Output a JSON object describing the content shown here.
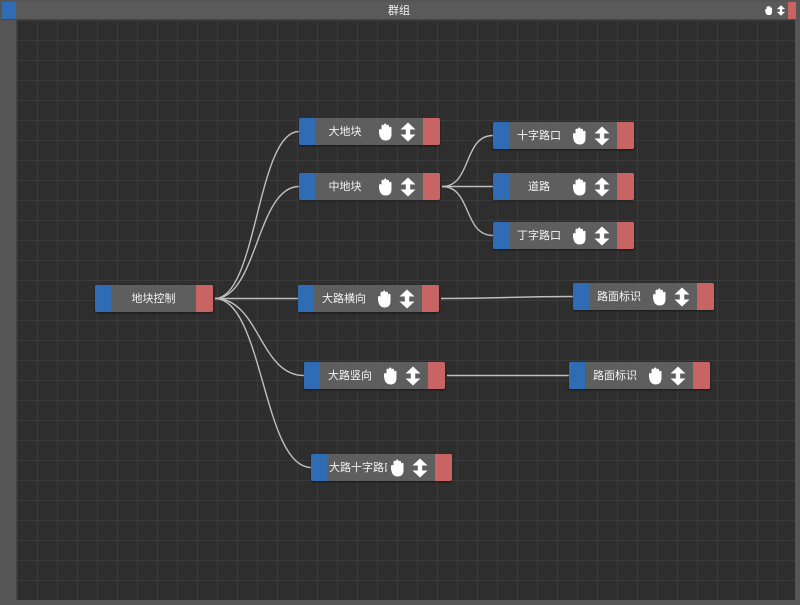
{
  "window": {
    "title": "群组"
  },
  "icons": {
    "grab": "hand-icon",
    "move": "vertical-move-icon"
  },
  "colors": {
    "input_port": "#2f6cb3",
    "output_port": "#c96464",
    "node_body": "#5e5e5e",
    "canvas": "#2e2e2e",
    "edge": "#bfbfbf"
  },
  "nodes": [
    {
      "id": "root",
      "label": "地块控制",
      "has_icons": false
    },
    {
      "id": "big",
      "label": "大地块",
      "has_icons": true
    },
    {
      "id": "mid",
      "label": "中地块",
      "has_icons": true
    },
    {
      "id": "cross",
      "label": "十字路口",
      "has_icons": true
    },
    {
      "id": "road",
      "label": "道路",
      "has_icons": true
    },
    {
      "id": "tjunc",
      "label": "丁字路口",
      "has_icons": true
    },
    {
      "id": "hroad",
      "label": "大路横向",
      "has_icons": true
    },
    {
      "id": "mark1",
      "label": "路面标识",
      "has_icons": true
    },
    {
      "id": "vroad",
      "label": "大路竖向",
      "has_icons": true
    },
    {
      "id": "mark2",
      "label": "路面标识",
      "has_icons": true
    },
    {
      "id": "bigcross",
      "label": "大路十字路口",
      "has_icons": true
    }
  ],
  "edges": [
    [
      "root",
      "big"
    ],
    [
      "root",
      "mid"
    ],
    [
      "root",
      "hroad"
    ],
    [
      "root",
      "vroad"
    ],
    [
      "root",
      "bigcross"
    ],
    [
      "mid",
      "cross"
    ],
    [
      "mid",
      "road"
    ],
    [
      "mid",
      "tjunc"
    ],
    [
      "hroad",
      "mark1"
    ],
    [
      "vroad",
      "mark2"
    ]
  ]
}
